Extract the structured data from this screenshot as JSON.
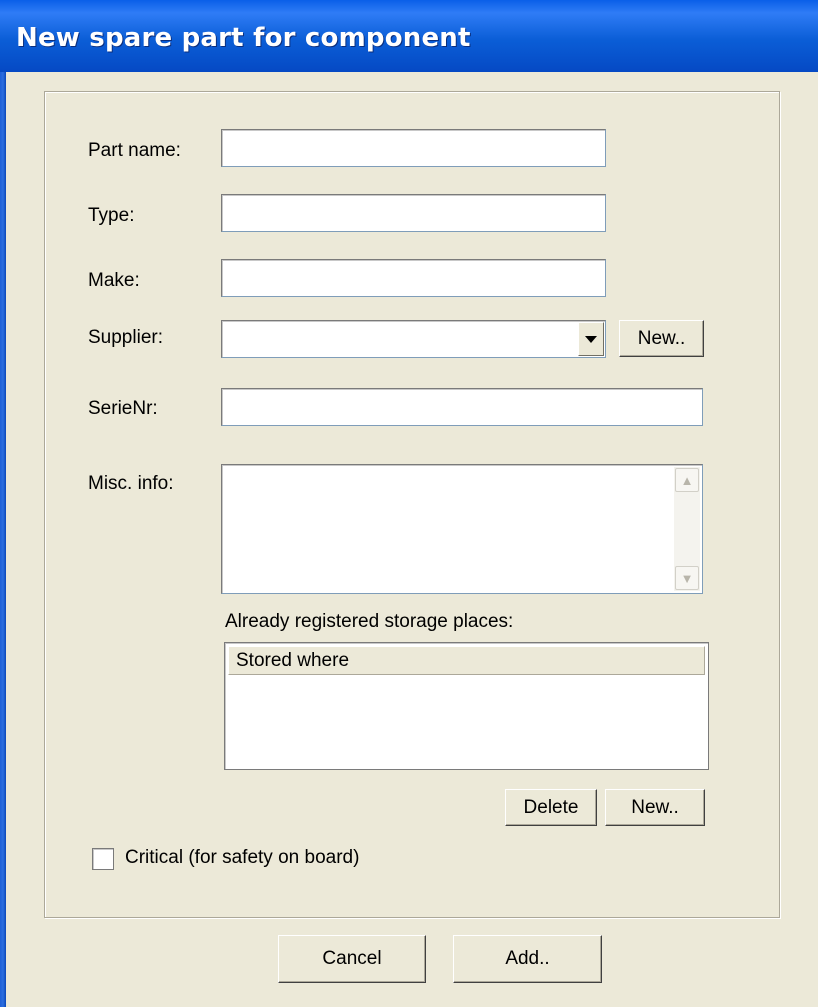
{
  "window": {
    "title": "New spare part for component"
  },
  "form": {
    "part_name": {
      "label": "Part name:",
      "value": ""
    },
    "type": {
      "label": "Type:",
      "value": ""
    },
    "make": {
      "label": "Make:",
      "value": ""
    },
    "supplier": {
      "label": "Supplier:",
      "selected": "",
      "new_label": "New.."
    },
    "serie_nr": {
      "label": "SerieNr:",
      "value": ""
    },
    "misc_info": {
      "label": "Misc. info:",
      "value": ""
    }
  },
  "storage": {
    "label": "Already registered storage places:",
    "columns": [
      "Stored where"
    ],
    "rows": [],
    "delete_label": "Delete",
    "new_label": "New.."
  },
  "critical": {
    "label": "Critical (for safety on board)",
    "checked": false
  },
  "footer": {
    "cancel_label": "Cancel",
    "add_label": "Add.."
  },
  "icons": {
    "combo": "chevron-down-icon",
    "scroll_up": "scroll-up-icon",
    "scroll_down": "scroll-down-icon"
  },
  "colors": {
    "titlebar": "#0b5ed7",
    "dialog_bg": "#ece9d8",
    "field_border": "#7f9db9"
  }
}
